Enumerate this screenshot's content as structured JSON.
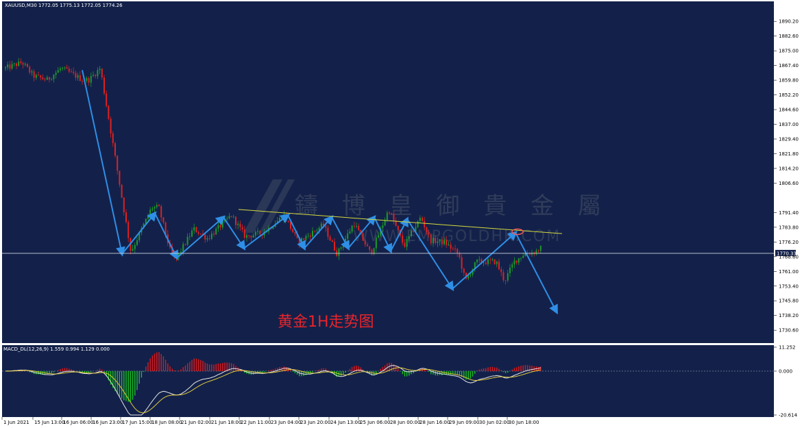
{
  "symbol_info": "XAUUSD,M30  1772.05 1775.13 1772.05 1774.26",
  "price_label": "1770.33",
  "annotation": "黄金1H走势图",
  "watermark": {
    "name": "鑄 博 皇 御 貴 金 屬",
    "url": "WWW.EMPGOLDHK.COM"
  },
  "macd_label": "MACD_DL(12,26,9) 1.559 0.994 1.129 0.000",
  "colors": {
    "background": "#13214a",
    "candle_up": "#1d9a2a",
    "candle_down": "#e0211f",
    "arrow": "#2f8fe6",
    "trendline": "#d7dc3c",
    "marker": "#f05a5a",
    "hist_pos": "#e01818",
    "hist_neg": "#18c21a"
  },
  "chart_data": [
    {
      "type": "candlestick",
      "title": "XAUUSD,M30",
      "y_ticks": [
        "1890.20",
        "1882.60",
        "1875.00",
        "1867.40",
        "1859.80",
        "1852.20",
        "1844.60",
        "1837.00",
        "1829.40",
        "1821.80",
        "1814.20",
        "1806.60",
        "1791.40",
        "1783.80",
        "1776.20",
        "1768.60",
        "1761.00",
        "1753.40",
        "1745.80",
        "1738.20",
        "1730.60"
      ],
      "ylim": [
        1725.0,
        1897.0
      ],
      "x_ticks": [
        "1 Jun 2021",
        "15 Jun 13:00",
        "16 Jun 06:00",
        "16 Jun 23:00",
        "17 Jun 15:00",
        "18 Jun 08:00",
        "21 Jun 02:00",
        "21 Jun 18:00",
        "22 Jun 11:00",
        "23 Jun 04:00",
        "23 Jun 20:00",
        "24 Jun 13:00",
        "25 Jun 06:00",
        "28 Jun 00:00",
        "28 Jun 16:00",
        "29 Jun 09:00",
        "30 Jun 02:00",
        "30 Jun 18:00"
      ],
      "n_bars": 245,
      "current_price": 1770.33,
      "price_path_anchors": [
        [
          0,
          1866
        ],
        [
          12,
          1869
        ],
        [
          20,
          1862
        ],
        [
          30,
          1860
        ],
        [
          40,
          1866
        ],
        [
          48,
          1863
        ],
        [
          55,
          1860
        ],
        [
          60,
          1860
        ],
        [
          68,
          1866
        ],
        [
          90,
          1771
        ],
        [
          105,
          1794
        ],
        [
          110,
          1794
        ],
        [
          118,
          1772
        ],
        [
          122,
          1767
        ],
        [
          135,
          1783
        ],
        [
          145,
          1778
        ],
        [
          162,
          1790
        ],
        [
          172,
          1779
        ],
        [
          185,
          1781
        ],
        [
          200,
          1790
        ],
        [
          210,
          1776
        ],
        [
          228,
          1785
        ],
        [
          238,
          1770
        ],
        [
          250,
          1786
        ],
        [
          262,
          1770
        ],
        [
          275,
          1793
        ],
        [
          286,
          1774
        ],
        [
          298,
          1789
        ],
        [
          305,
          1777
        ],
        [
          315,
          1776
        ],
        [
          325,
          1770
        ],
        [
          330,
          1756
        ],
        [
          338,
          1766
        ],
        [
          345,
          1766
        ],
        [
          352,
          1766
        ],
        [
          358,
          1756
        ],
        [
          365,
          1766
        ],
        [
          372,
          1770
        ],
        [
          380,
          1771
        ],
        [
          384,
          1773
        ]
      ],
      "waves": [
        [
          1865.0,
          1770.0
        ],
        [
          1770.0,
          1791.0
        ],
        [
          1791.0,
          1768.0
        ],
        [
          1768.0,
          1789.0
        ],
        [
          1789.0,
          1773.0
        ],
        [
          1773.0,
          1790.0
        ],
        [
          1790.0,
          1773.0
        ],
        [
          1773.0,
          1789.0
        ],
        [
          1789.0,
          1773.0
        ],
        [
          1773.0,
          1789.0
        ],
        [
          1789.0,
          1771.5
        ],
        [
          1771.5,
          1788.0
        ],
        [
          1788.0,
          1752.0
        ],
        [
          1752.0,
          1781.0
        ],
        [
          1781.0,
          1740.0
        ]
      ],
      "trendline": [
        1793.0,
        1780.5
      ],
      "marker_price": 1781.5
    },
    {
      "type": "macd",
      "title": "MACD_DL(12,26,9)",
      "values": [
        1.559,
        0.994,
        1.129,
        0.0
      ],
      "y_ticks": [
        "11.252",
        "0.000",
        "-20.614"
      ],
      "ylim": [
        -20.614,
        11.252
      ]
    }
  ]
}
